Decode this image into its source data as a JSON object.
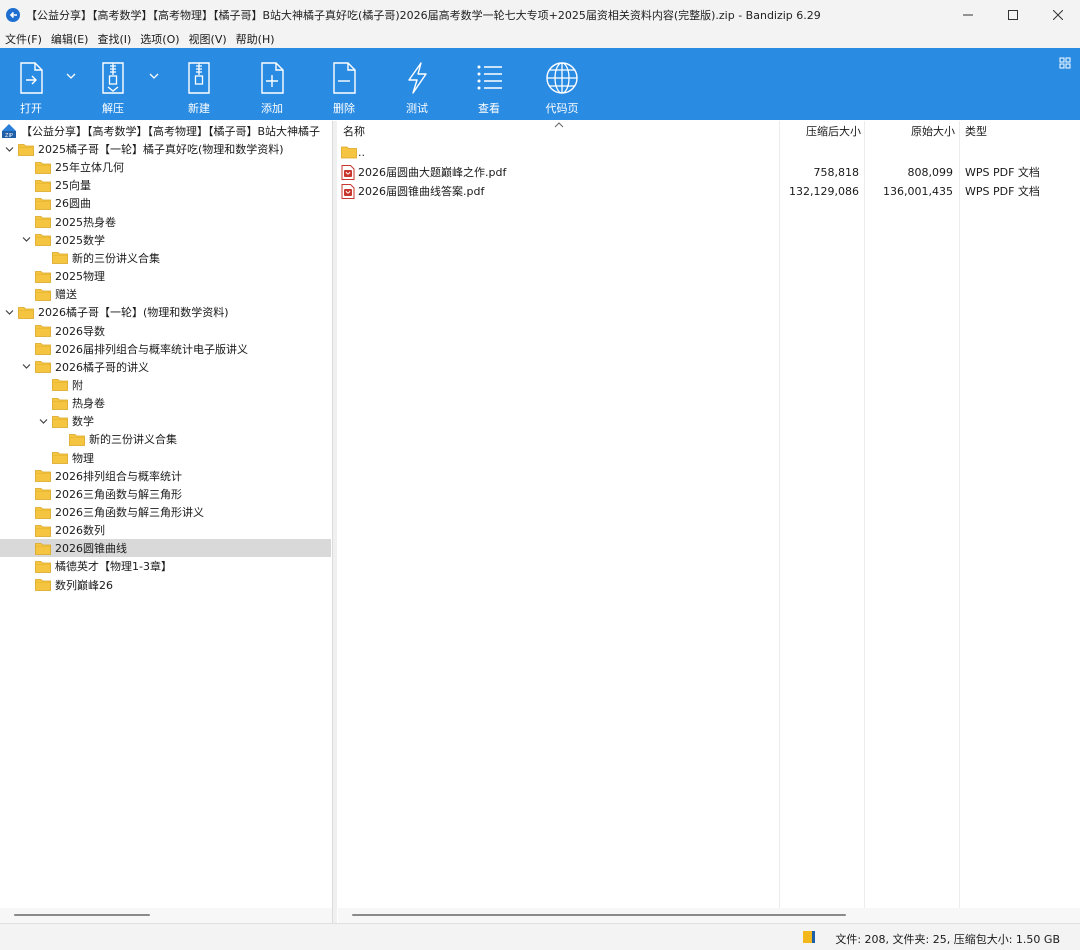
{
  "window": {
    "title": "【公益分享】【高考数学】【高考物理】【橘子哥】B站大神橘子真好吃(橘子哥)2026届高考数学一轮七大专项+2025届资相关资料内容(完整版).zip - Bandizip 6.29"
  },
  "menu": [
    "文件(F)",
    "编辑(E)",
    "查找(I)",
    "选项(O)",
    "视图(V)",
    "帮助(H)"
  ],
  "toolbar": {
    "open": "打开",
    "extract": "解压",
    "new": "新建",
    "add": "添加",
    "delete": "删除",
    "test": "测试",
    "view": "查看",
    "codepage": "代码页"
  },
  "tree": {
    "root": "【公益分享】【高考数学】【高考物理】【橘子哥】B站大神橘子",
    "items": [
      {
        "label": "2025橘子哥【一轮】橘子真好吃(物理和数学资料)",
        "depth": 0,
        "expanded": true
      },
      {
        "label": "25年立体几何",
        "depth": 1
      },
      {
        "label": "25向量",
        "depth": 1
      },
      {
        "label": "26圆曲",
        "depth": 1
      },
      {
        "label": "2025热身卷",
        "depth": 1
      },
      {
        "label": "2025数学",
        "depth": 1,
        "expanded": true
      },
      {
        "label": "新的三份讲义合集",
        "depth": 2
      },
      {
        "label": "2025物理",
        "depth": 1
      },
      {
        "label": "赠送",
        "depth": 1
      },
      {
        "label": "2026橘子哥【一轮】(物理和数学资料)",
        "depth": 0,
        "expanded": true
      },
      {
        "label": "2026导数",
        "depth": 1
      },
      {
        "label": "2026届排列组合与概率统计电子版讲义",
        "depth": 1
      },
      {
        "label": "2026橘子哥的讲义",
        "depth": 1,
        "expanded": true
      },
      {
        "label": "附",
        "depth": 2
      },
      {
        "label": "热身卷",
        "depth": 2
      },
      {
        "label": "数学",
        "depth": 2,
        "expanded": true
      },
      {
        "label": "新的三份讲义合集",
        "depth": 3
      },
      {
        "label": "物理",
        "depth": 2
      },
      {
        "label": "2026排列组合与概率统计",
        "depth": 1
      },
      {
        "label": "2026三角函数与解三角形",
        "depth": 1
      },
      {
        "label": "2026三角函数与解三角形讲义",
        "depth": 1
      },
      {
        "label": "2026数列",
        "depth": 1
      },
      {
        "label": "2026圆锥曲线",
        "depth": 1,
        "selected": true
      },
      {
        "label": "橘德英才【物理1-3章】",
        "depth": 1
      },
      {
        "label": "数列巅峰26",
        "depth": 1
      }
    ]
  },
  "list": {
    "columns": {
      "name": "名称",
      "packed": "压缩后大小",
      "original": "原始大小",
      "type": "类型"
    },
    "rows": [
      {
        "name": "..",
        "packed": "",
        "original": "",
        "type": "",
        "kind": "folder"
      },
      {
        "name": "2026届圆曲大题巅峰之作.pdf",
        "packed": "758,818",
        "original": "808,099",
        "type": "WPS PDF 文档",
        "kind": "pdf"
      },
      {
        "name": "2026届圆锥曲线答案.pdf",
        "packed": "132,129,086",
        "original": "136,001,435",
        "type": "WPS PDF 文档",
        "kind": "pdf"
      }
    ]
  },
  "status": {
    "text": "文件: 208, 文件夹: 25, 压缩包大小: 1.50 GB"
  },
  "colors": {
    "toolbar": "#2a8be3",
    "folder": "#f5c542",
    "selected_row": "#d9d9d9",
    "pdf": "#c8372d"
  }
}
